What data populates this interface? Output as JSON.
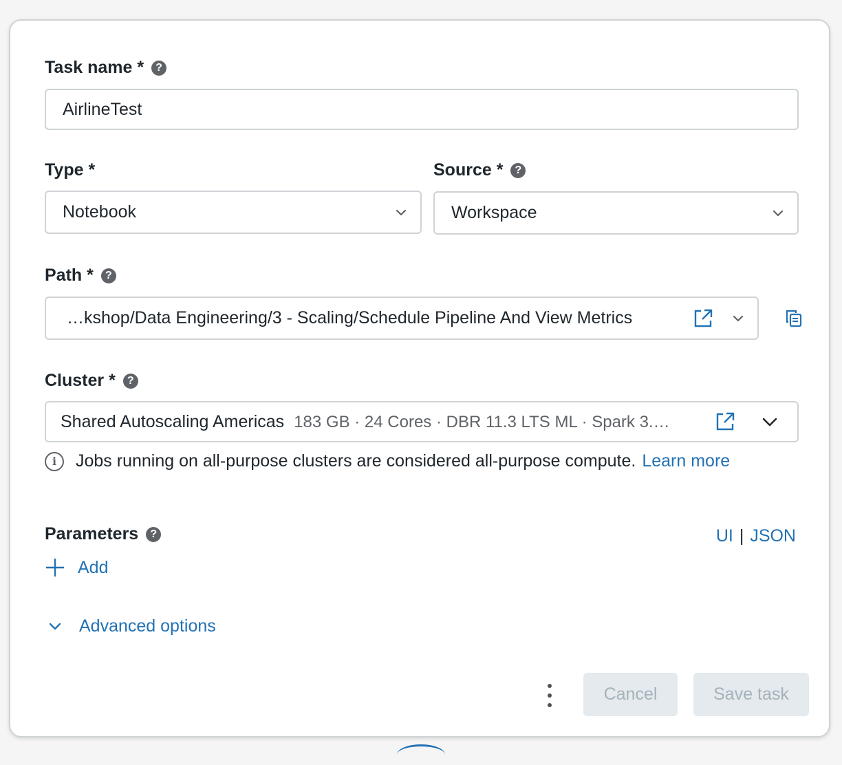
{
  "task_name": {
    "label": "Task name *",
    "value": "AirlineTest"
  },
  "type": {
    "label": "Type *",
    "value": "Notebook"
  },
  "source": {
    "label": "Source *",
    "value": "Workspace"
  },
  "path": {
    "label": "Path *",
    "value": "…kshop/Data Engineering/3 - Scaling/Schedule Pipeline And View Metrics"
  },
  "cluster": {
    "label": "Cluster *",
    "name": "Shared Autoscaling Americas",
    "details": "183 GB · 24 Cores · DBR 11.3 LTS ML · Spark 3.…",
    "info_text": "Jobs running on all-purpose clusters are considered all-purpose compute.",
    "learn_more": "Learn more"
  },
  "parameters": {
    "label": "Parameters",
    "mode_ui": "UI",
    "separator": "|",
    "mode_json": "JSON",
    "add_label": "Add"
  },
  "advanced": {
    "label": "Advanced options"
  },
  "footer": {
    "cancel_label": "Cancel",
    "save_label": "Save task"
  },
  "icons": {
    "help": "question-circle-icon",
    "chevron": "chevron-down-icon",
    "external": "external-link-icon",
    "copy": "copy-icon",
    "info": "info-circle-icon",
    "plus": "plus-icon",
    "kebab": "kebab-menu-icon"
  },
  "colors": {
    "accent": "#2272b4",
    "text": "#1f272d",
    "border": "#cfd3d6",
    "disabled_bg": "#e4eaee",
    "disabled_text": "#a6b2ba"
  }
}
